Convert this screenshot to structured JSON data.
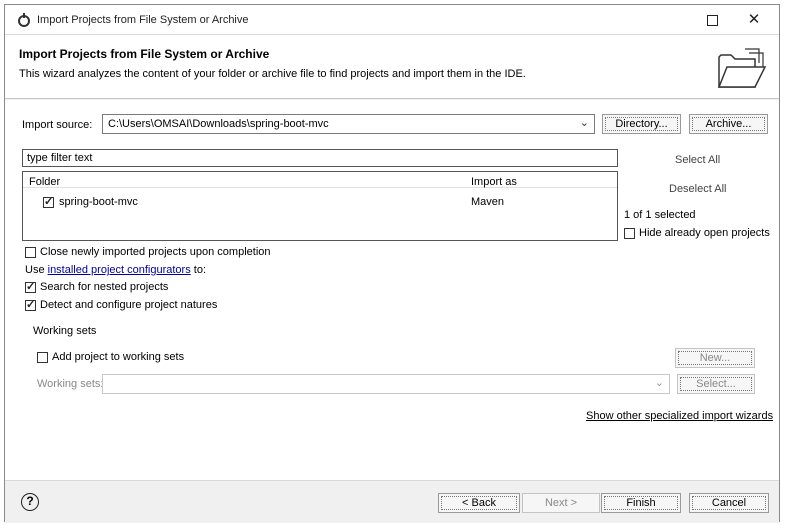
{
  "window": {
    "title": "Import Projects from File System or Archive"
  },
  "header": {
    "title": "Import Projects from File System or Archive",
    "description": "This wizard analyzes the content of your folder or archive file to find projects and import them in the IDE.",
    "icon": "folder-open-icon"
  },
  "import_source": {
    "label": "Import source:",
    "value": "C:\\Users\\OMSAI\\Downloads\\spring-boot-mvc",
    "directory_button": "Directory...",
    "archive_button": "Archive..."
  },
  "filter": {
    "placeholder": "type filter text"
  },
  "tree": {
    "columns": [
      "Folder",
      "Import as"
    ],
    "rows": [
      {
        "folder": "spring-boot-mvc",
        "import_as": "Maven",
        "checked": true
      }
    ]
  },
  "selection": {
    "select_all": "Select All",
    "deselect_all": "Deselect All",
    "count": "1 of 1 selected",
    "hide_open_label": "Hide already open projects",
    "hide_open_checked": false
  },
  "options": {
    "close_label": "Close newly imported projects upon completion",
    "close_checked": false,
    "use_prefix": "Use",
    "installed_link": "installed project configurators",
    "use_suffix": "to:",
    "nested_label": "Search for nested projects",
    "nested_checked": true,
    "detect_label": "Detect and configure project natures",
    "detect_checked": true
  },
  "working_sets": {
    "group_label": "Working sets",
    "add_label": "Add project to working sets",
    "add_checked": false,
    "new_button": "New...",
    "field_label": "Working sets:",
    "select_button": "Select..."
  },
  "footer": {
    "wizards_link": "Show other specialized import wizards",
    "back_button": "< Back",
    "next_button": "Next >",
    "finish_button": "Finish",
    "cancel_button": "Cancel",
    "help_icon": "help-icon",
    "help_glyph": "?"
  }
}
